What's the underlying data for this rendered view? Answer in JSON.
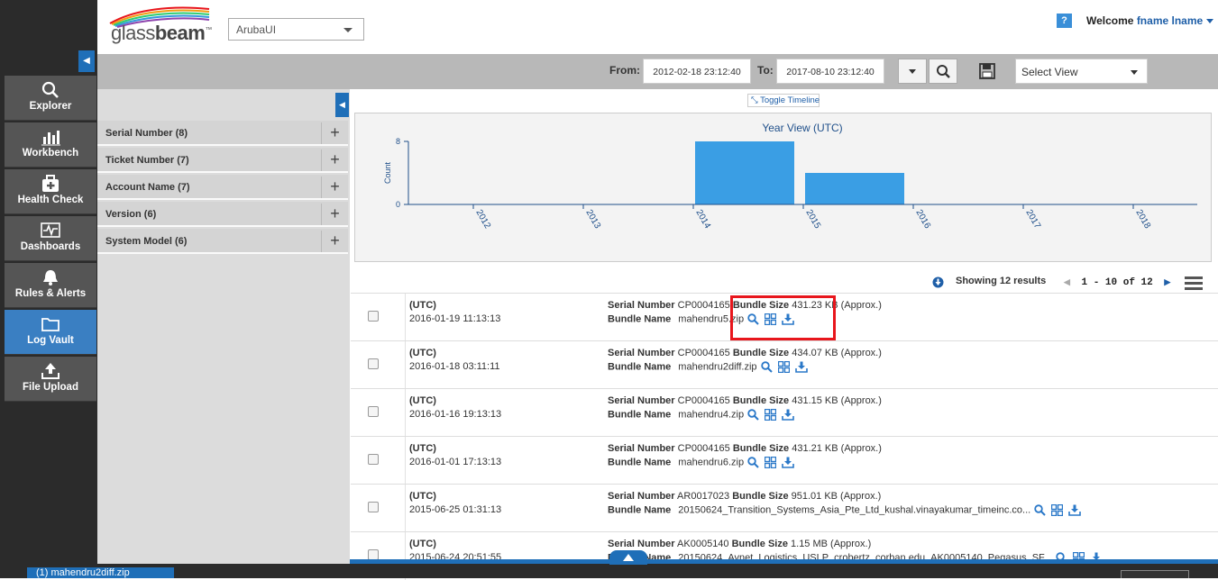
{
  "brand": {
    "logo_text_1": "glass",
    "logo_text_2": "beam",
    "tm": "™"
  },
  "app_selector": {
    "value": "ArubaUI"
  },
  "header": {
    "help": "?",
    "welcome_label": "Welcome",
    "user_name": "fname lname"
  },
  "nav": {
    "items": [
      {
        "label": "Explorer",
        "icon": "search-icon"
      },
      {
        "label": "Workbench",
        "icon": "bar-chart-icon"
      },
      {
        "label": "Health Check",
        "icon": "medkit-icon"
      },
      {
        "label": "Dashboards",
        "icon": "pulse-icon"
      },
      {
        "label": "Rules & Alerts",
        "icon": "bell-icon"
      },
      {
        "label": "Log Vault",
        "icon": "folder-icon",
        "active": true
      },
      {
        "label": "File Upload",
        "icon": "upload-icon"
      }
    ]
  },
  "toolbar": {
    "from_label": "From:",
    "from_value": "2012-02-18 23:12:40",
    "to_label": "To:",
    "to_value": "2017-08-10 23:12:40",
    "select_view_placeholder": "Select View"
  },
  "facets": [
    {
      "label": "Serial Number (8)"
    },
    {
      "label": "Ticket Number (7)"
    },
    {
      "label": "Account Name (7)"
    },
    {
      "label": "Version (6)"
    },
    {
      "label": "System Model (6)"
    }
  ],
  "facet_plus": "+",
  "timeline": {
    "toggle_label": "Toggle Timeline"
  },
  "chart_data": {
    "type": "bar",
    "title": "Year View (UTC)",
    "ylabel": "Count",
    "xlabel": "",
    "categories": [
      "2012",
      "2013",
      "2014",
      "2015",
      "2016",
      "2017",
      "2018"
    ],
    "values": [
      0,
      0,
      0,
      8,
      4,
      0,
      0
    ],
    "ylim": [
      0,
      8
    ],
    "yticks": [
      "0",
      "8"
    ],
    "bar_color": "#3a9ee4"
  },
  "results": {
    "showing": "Showing 12 results",
    "pager": "1 - 10 of 12",
    "serial_label": "Serial Number",
    "bundle_size_label": "Bundle Size",
    "bundle_name_label": "Bundle Name",
    "tz": "(UTC)",
    "rows": [
      {
        "timestamp": "2016-01-19 11:13:13",
        "serial": "CP0004165",
        "size": "431.23 KB (Approx.)",
        "name": "mahendru5.zip"
      },
      {
        "timestamp": "2016-01-18 03:11:11",
        "serial": "CP0004165",
        "size": "434.07 KB (Approx.)",
        "name": "mahendru2diff.zip"
      },
      {
        "timestamp": "2016-01-16 19:13:13",
        "serial": "CP0004165",
        "size": "431.15 KB (Approx.)",
        "name": "mahendru4.zip"
      },
      {
        "timestamp": "2016-01-01 17:13:13",
        "serial": "CP0004165",
        "size": "431.21 KB (Approx.)",
        "name": "mahendru6.zip"
      },
      {
        "timestamp": "2015-06-25 01:31:13",
        "serial": "AR0017023",
        "size": "951.01 KB (Approx.)",
        "name": "20150624_Transition_Systems_Asia_Pte_Ltd_kushal.vinayakumar_timeinc.co..."
      },
      {
        "timestamp": "2015-06-24 20:51:55",
        "serial": "AK0005140",
        "size": "1.15 MB (Approx.)",
        "name": "20150624_Avnet_Logistics_USLP_crobertz_corban.edu_AK0005140_Pegasus_SF..."
      }
    ]
  },
  "download_tab": {
    "label": "(1) mahendru2diff.zip"
  }
}
